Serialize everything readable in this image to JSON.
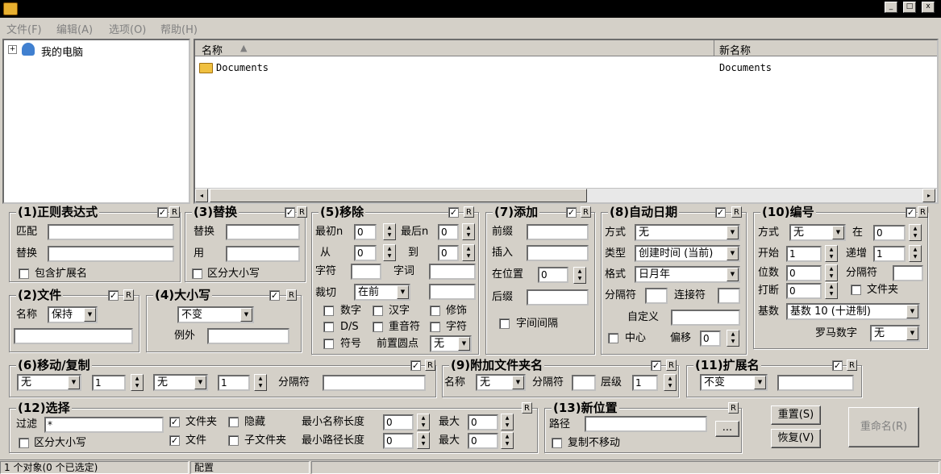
{
  "menu": [
    "文件(F)",
    "编辑(A)",
    "选项(O)",
    "帮助(H)"
  ],
  "titlebar": {
    "min": "_",
    "max": "□",
    "close": "x"
  },
  "tree": {
    "expander": "+",
    "root_label": "我的电脑"
  },
  "filelist": {
    "col_name": "名称",
    "col_newname": "新名称",
    "rows": [
      {
        "name": "Documents",
        "newname": "Documents"
      }
    ]
  },
  "g1": {
    "title": "(1)正则表达式",
    "match_label": "匹配",
    "replace_label": "替换",
    "include_ext": "包含扩展名"
  },
  "g3": {
    "title": "(3)替换",
    "replace_label": "替换",
    "with_label": "用",
    "case_sensitive": "区分大小写"
  },
  "g5": {
    "title": "(5)移除",
    "first_n": "最初n",
    "last_n": "最后n",
    "from": "从",
    "to": "到",
    "chars": "字符",
    "words": "字词",
    "crop": "裁切",
    "crop_value": "在前",
    "digits": "数字",
    "chinese": "汉字",
    "trim": "修饰",
    "ds": "D/S",
    "accents": "重音符",
    "char2": "字符",
    "symbols": "符号",
    "lead_dots": "前置圆点",
    "lead_dots_value": "无",
    "v_first": "0",
    "v_last": "0",
    "v_from": "0",
    "v_to": "0"
  },
  "g7": {
    "title": "(7)添加",
    "prefix": "前缀",
    "insert": "插入",
    "at_pos": "在位置",
    "at_pos_value": "0",
    "suffix": "后缀",
    "word_space": "字间间隔"
  },
  "g8": {
    "title": "(8)自动日期",
    "mode": "方式",
    "mode_value": "无",
    "type": "类型",
    "type_value": "创建时间 (当前)",
    "format": "格式",
    "format_value": "日月年",
    "sep": "分隔符",
    "connector": "连接符",
    "custom": "自定义",
    "center": "中心",
    "offset": "偏移",
    "offset_value": "0"
  },
  "g10": {
    "title": "(10)编号",
    "mode": "方式",
    "mode_value": "无",
    "at": "在",
    "at_value": "0",
    "start": "开始",
    "start_value": "1",
    "incr": "递增",
    "incr_value": "1",
    "digits": "位数",
    "digits_value": "0",
    "sep": "分隔符",
    "break": "打断",
    "break_value": "0",
    "folder": "文件夹",
    "base": "基数",
    "base_value": "基数 10 (十进制)",
    "roman": "罗马数字",
    "roman_value": "无"
  },
  "g2": {
    "title": "(2)文件",
    "name_label": "名称",
    "name_value": "保持"
  },
  "g4": {
    "title": "(4)大小写",
    "case_value": "不变",
    "except": "例外"
  },
  "g6": {
    "title": "(6)移动/复制",
    "sel1": "无",
    "num1": "1",
    "sel2": "无",
    "num2": "1",
    "sep": "分隔符"
  },
  "g9": {
    "title": "(9)附加文件夹名",
    "name": "名称",
    "name_value": "无",
    "sep": "分隔符",
    "level": "层级",
    "level_value": "1"
  },
  "g11": {
    "title": "(11)扩展名",
    "value": "不变"
  },
  "g12": {
    "title": "(12)选择",
    "filter": "过滤",
    "filter_value": "*",
    "case": "区分大小写",
    "folders": "文件夹",
    "hidden": "隐藏",
    "files": "文件",
    "subfolders": "子文件夹",
    "min_name": "最小名称长度",
    "min_path": "最小路径长度",
    "max": "最大",
    "v1": "0",
    "v2": "0",
    "v3": "0",
    "v4": "0"
  },
  "g13": {
    "title": "(13)新位置",
    "path": "路径",
    "browse": "...",
    "copy_no_move": "复制不移动"
  },
  "buttons": {
    "reset": "重置(S)",
    "revert": "恢复(V)",
    "rename": "重命名(R)"
  },
  "status": {
    "objects": "1 个对象(0 个已选定)",
    "config": "配置"
  },
  "colors": {
    "titlebar": "#000000",
    "window": "#d4d0c8",
    "folder": "#f0c040"
  }
}
